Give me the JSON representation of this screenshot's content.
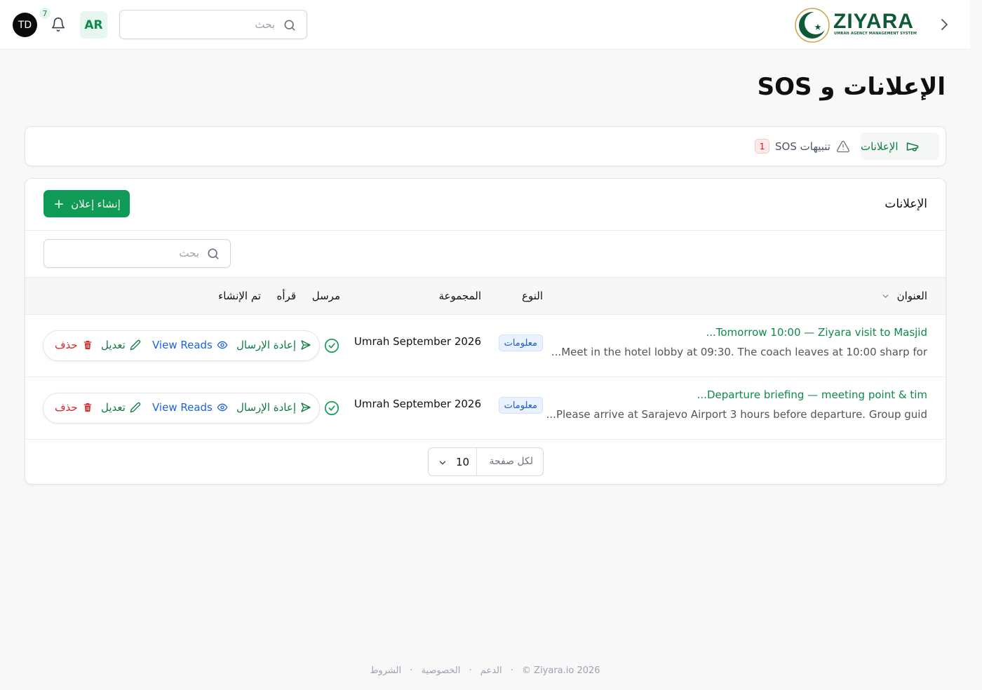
{
  "header": {
    "avatar_initials": "TD",
    "notification_count": "7",
    "language": "AR",
    "search_placeholder": "بحث",
    "logo_name": "ZIYARA",
    "logo_tagline": "UMRAH AGENCY MANAGEMENT SYSTEM"
  },
  "page": {
    "title": "الإعلانات و SOS"
  },
  "tabs": [
    {
      "label": "الإعلانات",
      "icon": "megaphone-icon",
      "active": true
    },
    {
      "label": "تنبيهات SOS",
      "icon": "warning-icon",
      "badge": "1",
      "active": false
    }
  ],
  "announcements": {
    "card_title": "الإعلانات",
    "create_label": "إنشاء إعلان",
    "search_placeholder": "بحث",
    "columns": {
      "title": "العنوان",
      "type": "النوع",
      "group": "المجموعة",
      "sender": "مرسل",
      "reads": "قرأه",
      "created": "تم الإنشاء"
    },
    "rows": [
      {
        "title": "Tomorrow 10:00 — Ziyara visit to Masjid...",
        "snippet": "Meet in the hotel lobby at 09:30. The coach leaves at 10:00 sharp for...",
        "type": "معلومات",
        "group": "Umrah September 2026",
        "sent": true
      },
      {
        "title": "Departure briefing — meeting point & tim...",
        "snippet": "Please arrive at Sarajevo Airport 3 hours before departure. Group guid...",
        "type": "معلومات",
        "group": "Umrah September 2026",
        "sent": true
      }
    ],
    "actions": {
      "resend": "إعادة الإرسال",
      "view_reads": "View Reads",
      "edit": "تعديل",
      "delete": "حذف"
    },
    "pagination": {
      "per_page_label": "لكل صفحة",
      "per_page_value": "10"
    }
  },
  "footer": {
    "copyright": "© Ziyara.io 2026",
    "terms": "الشروط",
    "privacy": "الخصوصية",
    "support": "الدعم",
    "separator": "·"
  },
  "colors": {
    "brand_green": "#0f9a55",
    "link_green": "#0c8a4a",
    "danger": "#dc2626",
    "info_blue": "#1d63d8"
  }
}
